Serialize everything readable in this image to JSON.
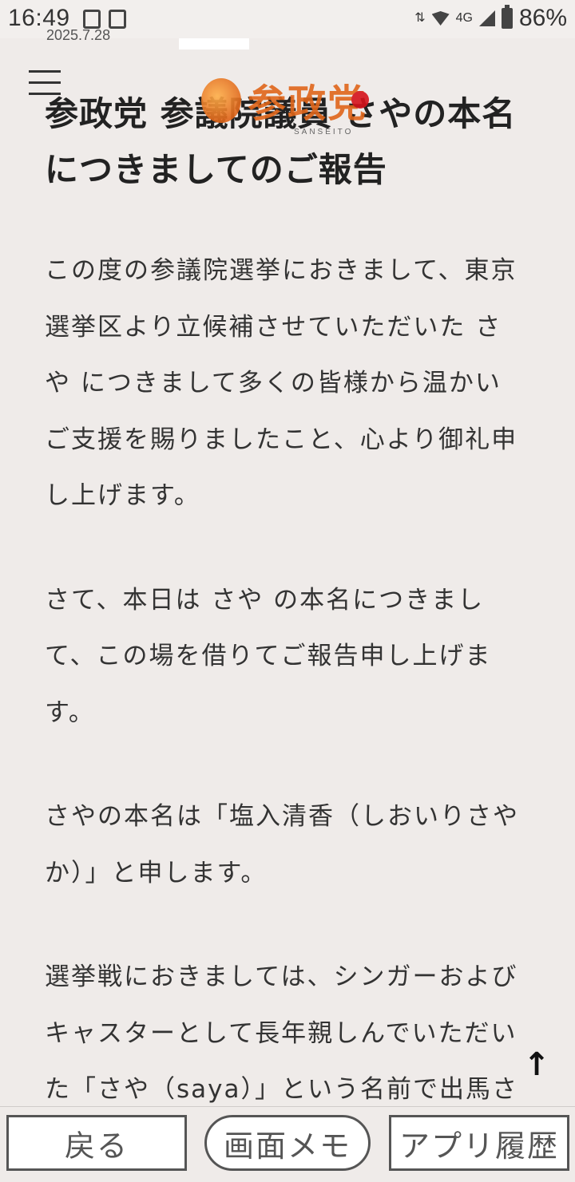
{
  "status_bar": {
    "time": "16:49",
    "network": "4G",
    "battery": "86%"
  },
  "header": {
    "date_partial": "2025.7.28",
    "logo_text": "参政党",
    "logo_sub": "SANSEITO"
  },
  "article": {
    "title": "参政党 参議院議員 さやの本名につきましてのご報告",
    "paragraphs": [
      "この度の参議院選挙におきまして、東京選挙区より立候補させていただいた さや につきまして多くの皆様から温かいご支援を賜りましたこと、心より御礼申し上げます。",
      "さて、本日は さや の本名につきまして、この場を借りてご報告申し上げます。",
      "さやの本名は「塩入清香（しおいりさやか）」と申します。",
      "選挙戦におきましては、シンガーおよびキャスターとして長年親しんでいただいた「さや（saya）」という名前で出馬させていただきました。これは、"
    ]
  },
  "scroll_top": "↑",
  "bottom_bar": {
    "back": "戻る",
    "memo": "画面メモ",
    "history": "アプリ履歴"
  }
}
